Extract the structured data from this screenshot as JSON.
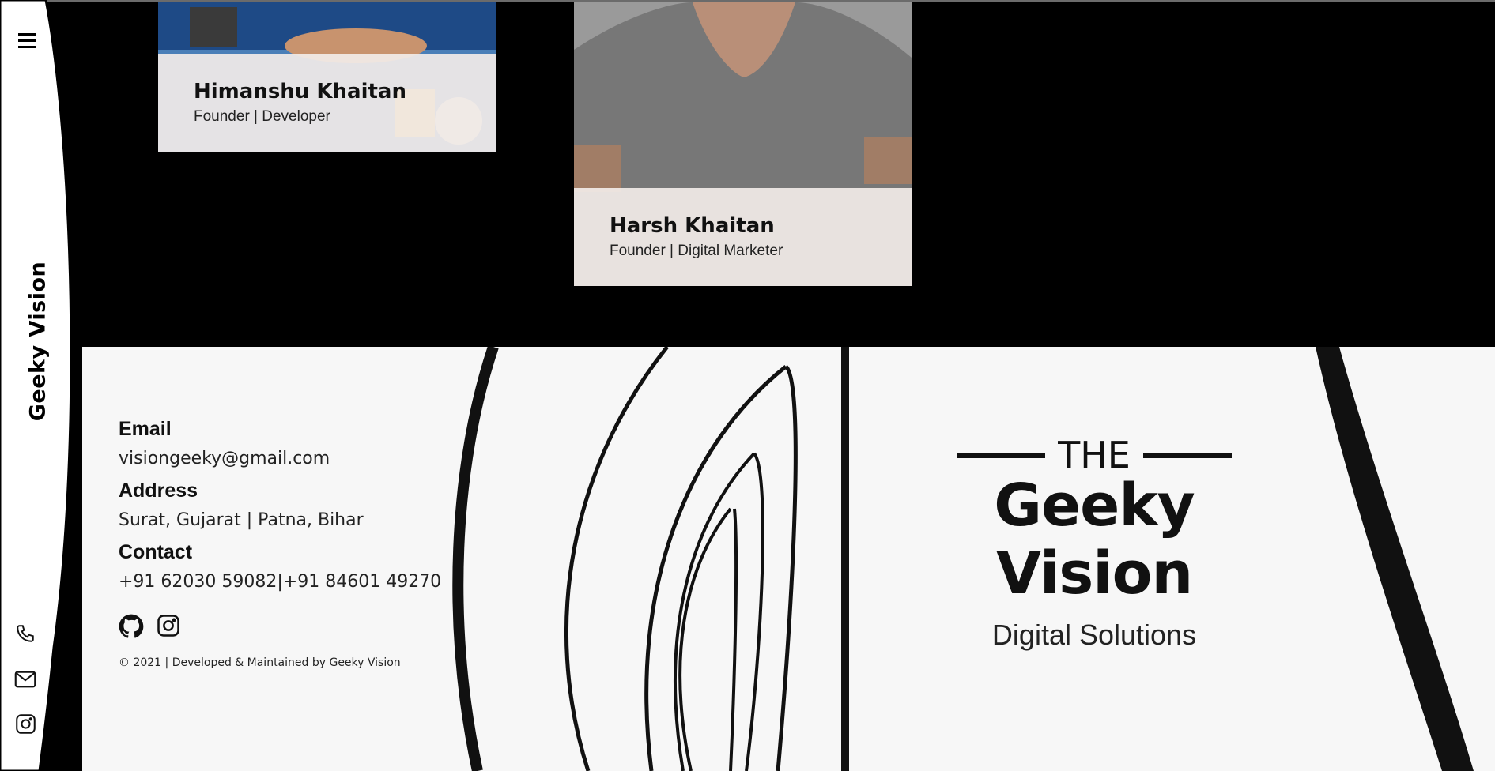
{
  "brand": {
    "vertical_name": "Geeky Vision"
  },
  "sidebar": {
    "icons": [
      "menu-icon",
      "phone-icon",
      "mail-icon",
      "instagram-icon"
    ]
  },
  "team": [
    {
      "name": "Himanshu Khaitan",
      "role": "Founder | Developer"
    },
    {
      "name": "Harsh Khaitan",
      "role": "Founder | Digital Marketer"
    }
  ],
  "footer": {
    "email_label": "Email",
    "email_value": "visiongeeky@gmail.com",
    "address_label": "Address",
    "address_value": "Surat, Gujarat | Patna, Bihar",
    "contact_label": "Contact",
    "contact_value": "+91 62030 59082|+91 84601 49270",
    "socials": [
      "github-icon",
      "instagram-icon"
    ],
    "copyright": "© 2021 | Developed & Maintained by Geeky Vision"
  },
  "logo": {
    "prefix": "THE",
    "name": "Geeky Vision",
    "tagline": "Digital Solutions"
  }
}
